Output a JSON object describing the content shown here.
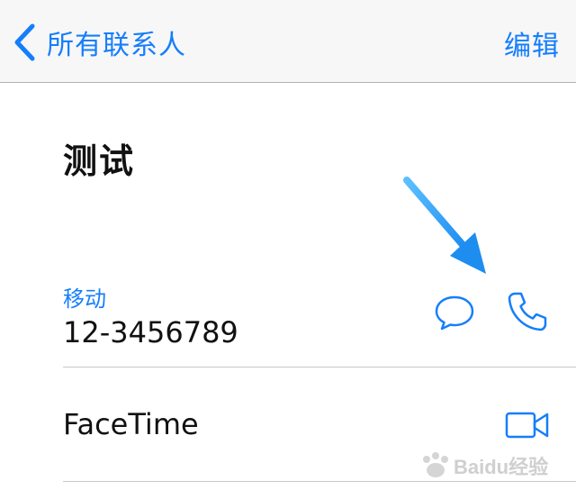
{
  "navbar": {
    "back_label": "所有联系人",
    "edit_label": "编辑"
  },
  "contact": {
    "name": "测试"
  },
  "phone": {
    "label": "移动",
    "number": "12-3456789",
    "message_icon": "message-bubble-icon",
    "call_icon": "phone-icon"
  },
  "facetime": {
    "label": "FaceTime",
    "video_icon": "video-camera-icon"
  },
  "colors": {
    "accent": "#157efb",
    "navbar_bg": "#f7f7f8",
    "arrow": "#2b9ff5"
  },
  "watermark": {
    "text": "Baidu经验"
  }
}
